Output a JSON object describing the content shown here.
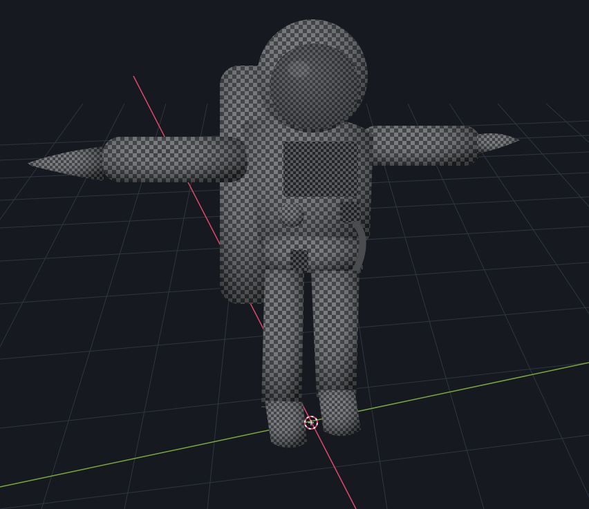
{
  "viewport": {
    "background": "#161a20",
    "grid_color": "#3a4150",
    "axis_x_color": "#e0486b",
    "axis_y_color": "#7aa93c"
  },
  "scene": {
    "object": "astronaut-model",
    "pose": "t-pose",
    "material": "checker-texture",
    "checker_dark": "#2b2d31",
    "checker_light": "#6c6e72"
  },
  "icons": {
    "cursor": "3d-cursor-icon"
  }
}
